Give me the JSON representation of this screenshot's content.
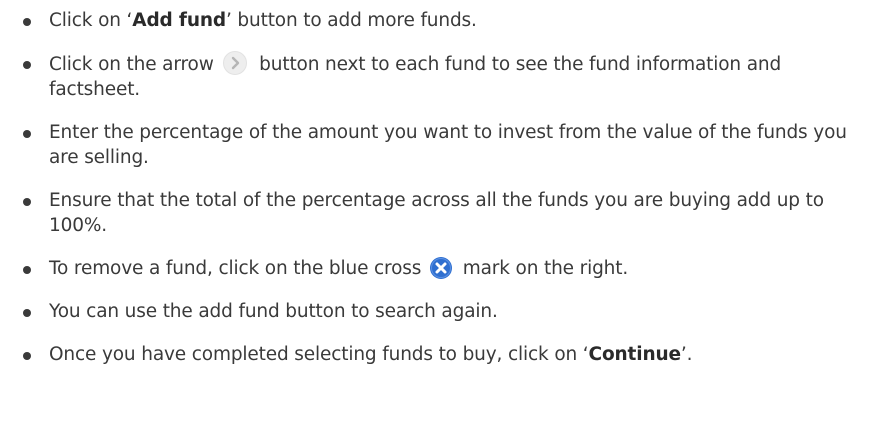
{
  "instructions": [
    {
      "pre": "Click on ‘",
      "bold": "Add fund",
      "post": "’  button to add more funds."
    },
    {
      "pre": "Click on the arrow",
      "icon": "chevron-right-circle-icon",
      "post": "button next to each fund to see the fund information and factsheet."
    },
    {
      "text": "Enter the percentage of the amount you want to invest from the value of the funds you are selling."
    },
    {
      "text": "Ensure that the total of the percentage across all the funds you are buying add up to 100%."
    },
    {
      "pre": "To remove a fund, click on the blue cross",
      "icon": "blue-cross-circle-icon",
      "post": "mark on the right."
    },
    {
      "text": "You can use the add fund button to search again."
    },
    {
      "pre": "Once you have completed selecting funds to buy, click on ‘",
      "bold": "Continue",
      "post": "’."
    }
  ],
  "colors": {
    "text": "#3a3a3a",
    "cross_icon": "#2f6fd0",
    "arrow_icon_bg": "#eeeeee",
    "arrow_icon_fg": "#b5b5b5"
  }
}
